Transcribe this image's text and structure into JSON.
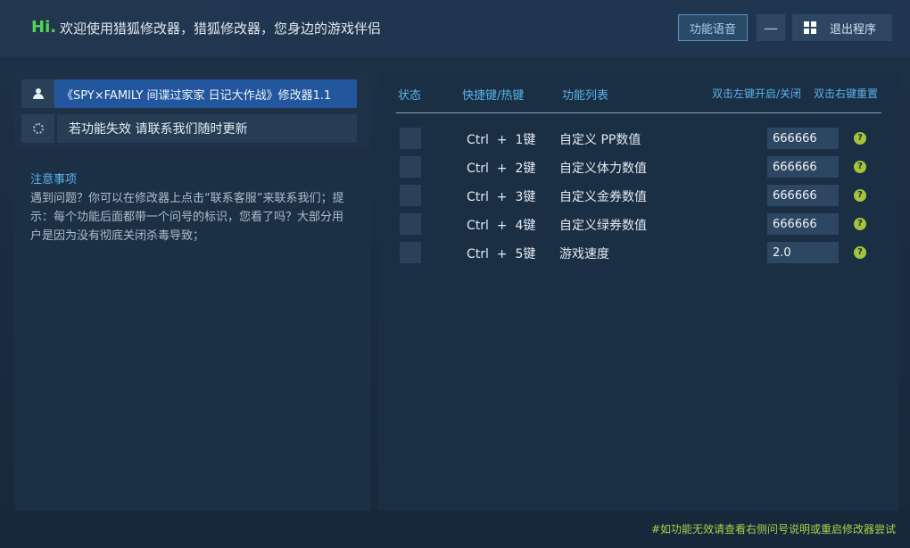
{
  "header": {
    "hi": "Hi.",
    "welcome": "欢迎使用猎狐修改器，猎狐修改器，您身边的游戏伴侣",
    "voice_button": "功能语音",
    "minimize_button": "—",
    "exit_button": "退出程序"
  },
  "left": {
    "game_title": "《SPY×FAMILY 间谍过家家 日记大作战》修改器1.1",
    "notice": "若功能失效  请联系我们随时更新",
    "notes_title": "注意事项",
    "notes_body": "遇到问题？你可以在修改器上点击“联系客服”来联系我们；提示：每个功能后面都带一个问号的标识，您看了吗？大部分用户是因为没有彻底关闭杀毒导致；"
  },
  "table": {
    "col_status": "状态",
    "col_hotkey": "快捷键/热键",
    "col_function": "功能列表",
    "hint_left": "双击左键开启/关闭",
    "hint_right": "双击右键重置",
    "rows": [
      {
        "hotkey": "Ctrl  +  1键",
        "function": "自定义 PP数值",
        "value": "666666",
        "help": "?"
      },
      {
        "hotkey": "Ctrl  +  2键",
        "function": "自定义体力数值",
        "value": "666666",
        "help": "?"
      },
      {
        "hotkey": "Ctrl  +  3键",
        "function": "自定义金券数值",
        "value": "666666",
        "help": "?"
      },
      {
        "hotkey": "Ctrl  +  4键",
        "function": "自定义绿券数值",
        "value": "666666",
        "help": "?"
      },
      {
        "hotkey": "Ctrl  +  5键",
        "function": "游戏速度",
        "value": "2.0",
        "help": "?"
      }
    ]
  },
  "footer": "#如功能无效请查看右侧问号说明或重启修改器尝试"
}
